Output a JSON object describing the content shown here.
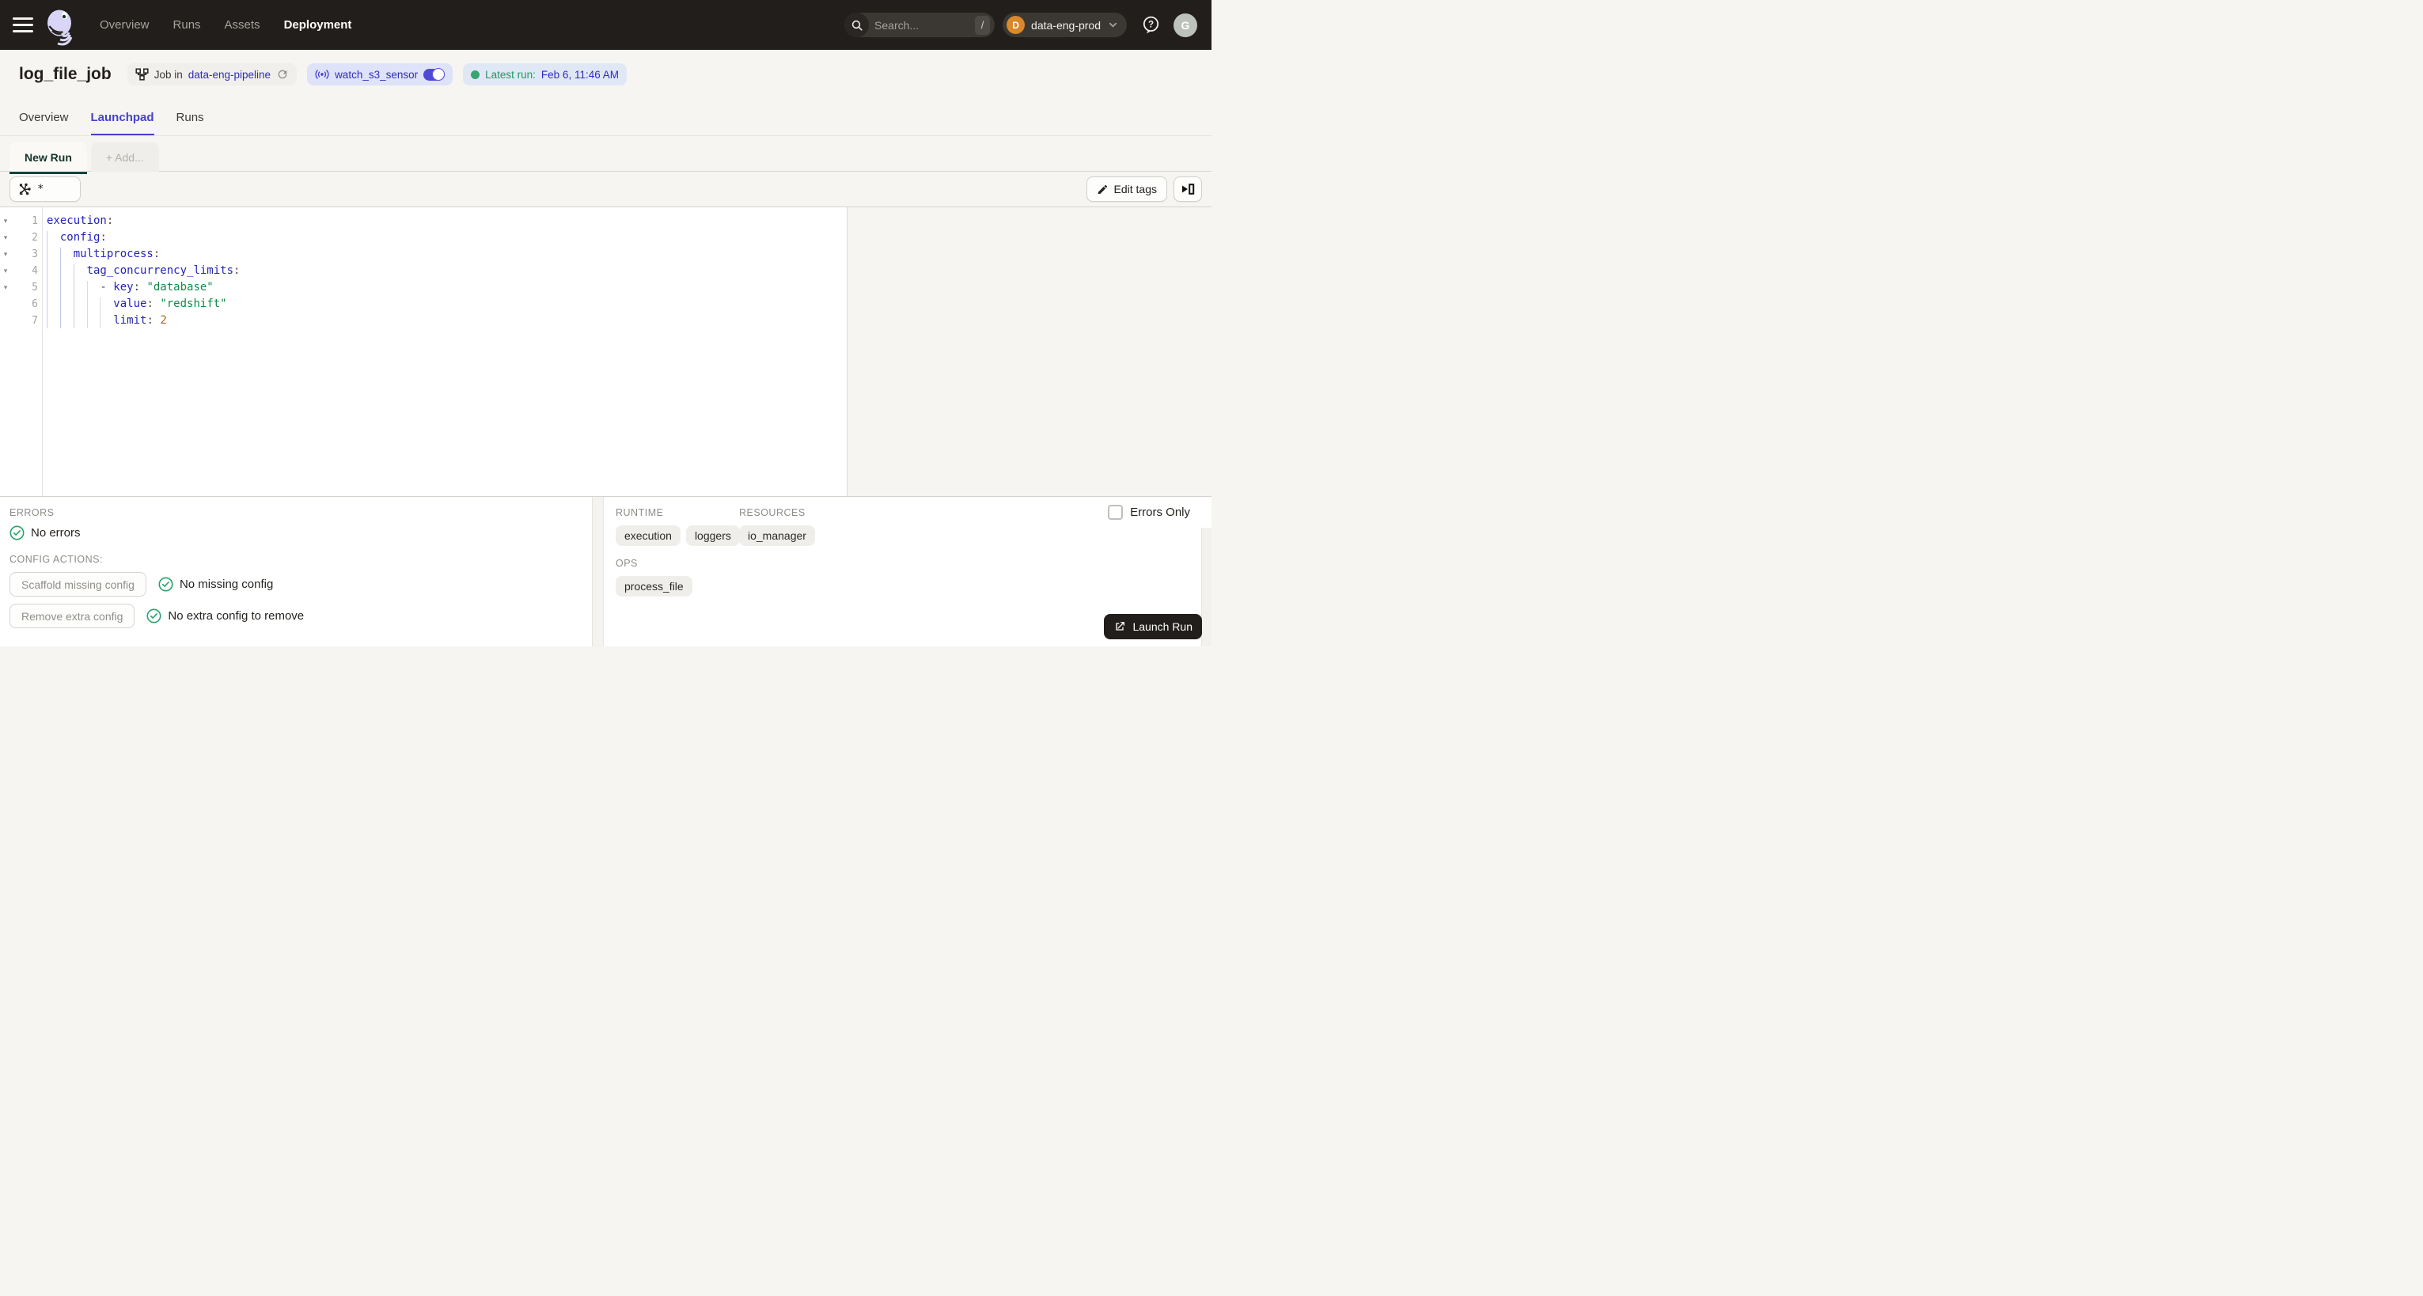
{
  "colors": {
    "nav_bg": "#211E1B",
    "page_bg": "#F6F5F2",
    "accent_indigo": "#4540CF",
    "link_blue": "#2F2BC4",
    "green": "#27A36C",
    "newrun_underline": "#12423A",
    "yaml_key": "#2523BE",
    "yaml_string": "#128A4A",
    "yaml_number": "#A8681C"
  },
  "navbar": {
    "links": [
      {
        "label": "Overview",
        "active": false
      },
      {
        "label": "Runs",
        "active": false
      },
      {
        "label": "Assets",
        "active": false
      },
      {
        "label": "Deployment",
        "active": true
      }
    ],
    "search": {
      "placeholder": "Search...",
      "shortcut": "/"
    },
    "deployment_switcher": {
      "initial": "D",
      "name": "data-eng-prod"
    },
    "user_initial": "G"
  },
  "header": {
    "title": "log_file_job",
    "job_badge": {
      "prefix": "Job in",
      "repo": "data-eng-pipeline"
    },
    "sensor_badge": {
      "name": "watch_s3_sensor"
    },
    "latest_run_badge": {
      "label": "Latest run:",
      "value": "Feb 6, 11:46 AM"
    }
  },
  "tabs": [
    {
      "label": "Overview"
    },
    {
      "label": "Launchpad"
    },
    {
      "label": "Runs"
    }
  ],
  "launchpad": {
    "run_tabs": {
      "new_run": "New Run",
      "add": "+ Add..."
    },
    "op_selector_value": "*",
    "edit_tags_label": "Edit tags"
  },
  "editor": {
    "lines": [
      {
        "num": 1,
        "fold": true,
        "segs": [
          [
            "k",
            "execution"
          ],
          [
            "p",
            ":"
          ]
        ]
      },
      {
        "num": 2,
        "fold": true,
        "segs": [
          [
            "p",
            "  "
          ],
          [
            "k",
            "config"
          ],
          [
            "p",
            ":"
          ]
        ]
      },
      {
        "num": 3,
        "fold": true,
        "segs": [
          [
            "p",
            "    "
          ],
          [
            "k",
            "multiprocess"
          ],
          [
            "p",
            ":"
          ]
        ]
      },
      {
        "num": 4,
        "fold": true,
        "segs": [
          [
            "p",
            "      "
          ],
          [
            "k",
            "tag_concurrency_limits"
          ],
          [
            "p",
            ":"
          ]
        ]
      },
      {
        "num": 5,
        "fold": true,
        "segs": [
          [
            "p",
            "        - "
          ],
          [
            "k",
            "key"
          ],
          [
            "p",
            ": "
          ],
          [
            "s",
            "\"database\""
          ]
        ]
      },
      {
        "num": 6,
        "fold": false,
        "segs": [
          [
            "p",
            "          "
          ],
          [
            "k",
            "value"
          ],
          [
            "p",
            ": "
          ],
          [
            "s",
            "\"redshift\""
          ]
        ]
      },
      {
        "num": 7,
        "fold": false,
        "segs": [
          [
            "p",
            "          "
          ],
          [
            "k",
            "limit"
          ],
          [
            "p",
            ": "
          ],
          [
            "n",
            "2"
          ]
        ]
      }
    ],
    "guides": [
      [
        0,
        2,
        7,
        "b"
      ],
      [
        2,
        3,
        7,
        "b"
      ],
      [
        4,
        4,
        7,
        "b"
      ],
      [
        6,
        5,
        7,
        "g"
      ],
      [
        8,
        6,
        7,
        "g"
      ]
    ]
  },
  "panel": {
    "errors_label": "ERRORS",
    "no_errors": "No errors",
    "config_actions_label": "CONFIG ACTIONS:",
    "scaffold_button": "Scaffold missing config",
    "no_missing": "No missing config",
    "remove_button": "Remove extra config",
    "no_extra": "No extra config to remove",
    "runtime_label": "RUNTIME",
    "resources_label": "RESOURCES",
    "ops_label": "OPS",
    "runtime_tags": [
      "execution",
      "loggers"
    ],
    "resource_tags": [
      "io_manager"
    ],
    "op_tags": [
      "process_file"
    ],
    "errors_only_label": "Errors Only",
    "launch_button": "Launch Run"
  }
}
